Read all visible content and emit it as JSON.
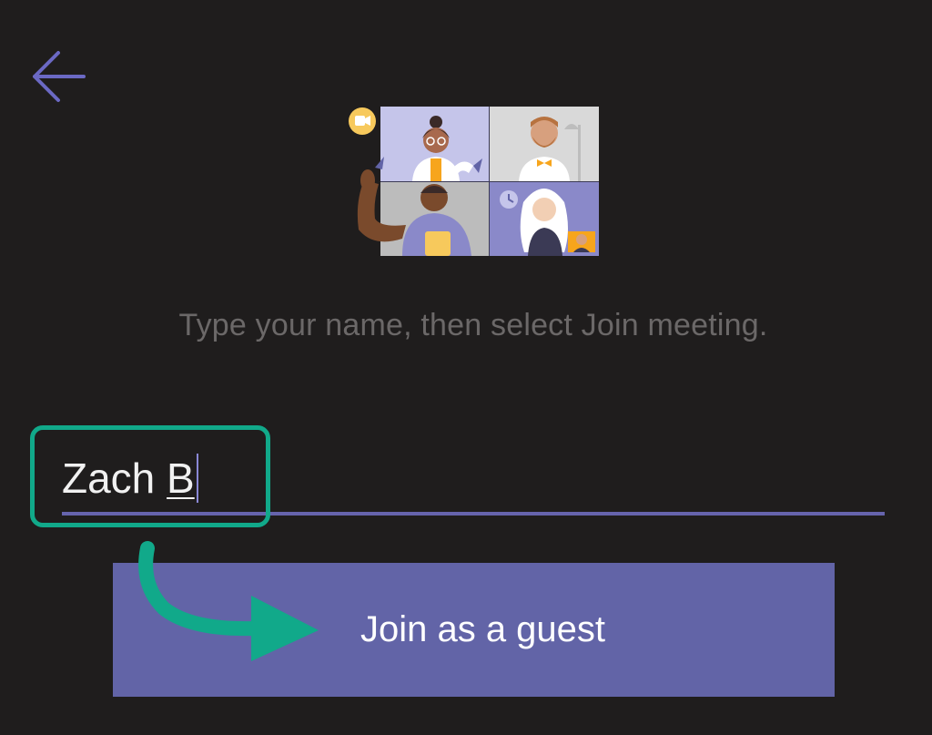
{
  "header": {
    "back_icon": "arrow-left-icon"
  },
  "illustration": {
    "icon": "video-meeting-illustration"
  },
  "instruction": {
    "text": "Type your name, then select Join meeting."
  },
  "name_field": {
    "value_first": "Zach ",
    "value_last": "B"
  },
  "join_button": {
    "label": "Join as a guest"
  },
  "colors": {
    "background": "#1f1d1d",
    "accent": "#6264a7",
    "annotation": "#11a98a",
    "instruction_text": "#6b6868"
  }
}
